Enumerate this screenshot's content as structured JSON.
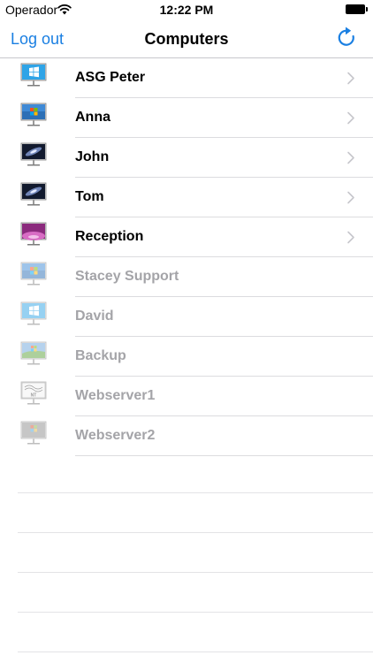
{
  "status_bar": {
    "carrier": "Operador",
    "time": "12:22 PM"
  },
  "nav": {
    "title": "Computers",
    "left_button": "Log out",
    "right_icon": "refresh-icon"
  },
  "colors": {
    "accent": "#1a7fe2",
    "offline_text": "#a4a4a8",
    "separator": "#dcdcdf"
  },
  "computers": [
    {
      "name": "ASG Peter",
      "os_icon": "windows8",
      "online": true
    },
    {
      "name": "Anna",
      "os_icon": "windows7",
      "online": true
    },
    {
      "name": "John",
      "os_icon": "macos-galaxy",
      "online": true
    },
    {
      "name": "Tom",
      "os_icon": "macos-galaxy",
      "online": true
    },
    {
      "name": "Reception",
      "os_icon": "macos-pink",
      "online": true
    },
    {
      "name": "Stacey Support",
      "os_icon": "windows7",
      "online": false
    },
    {
      "name": "David",
      "os_icon": "windows8",
      "online": false
    },
    {
      "name": "Backup",
      "os_icon": "windows-xp",
      "online": false
    },
    {
      "name": "Webserver1",
      "os_icon": "windows-nt",
      "online": false
    },
    {
      "name": "Webserver2",
      "os_icon": "windows-xp-grey",
      "online": false
    }
  ]
}
